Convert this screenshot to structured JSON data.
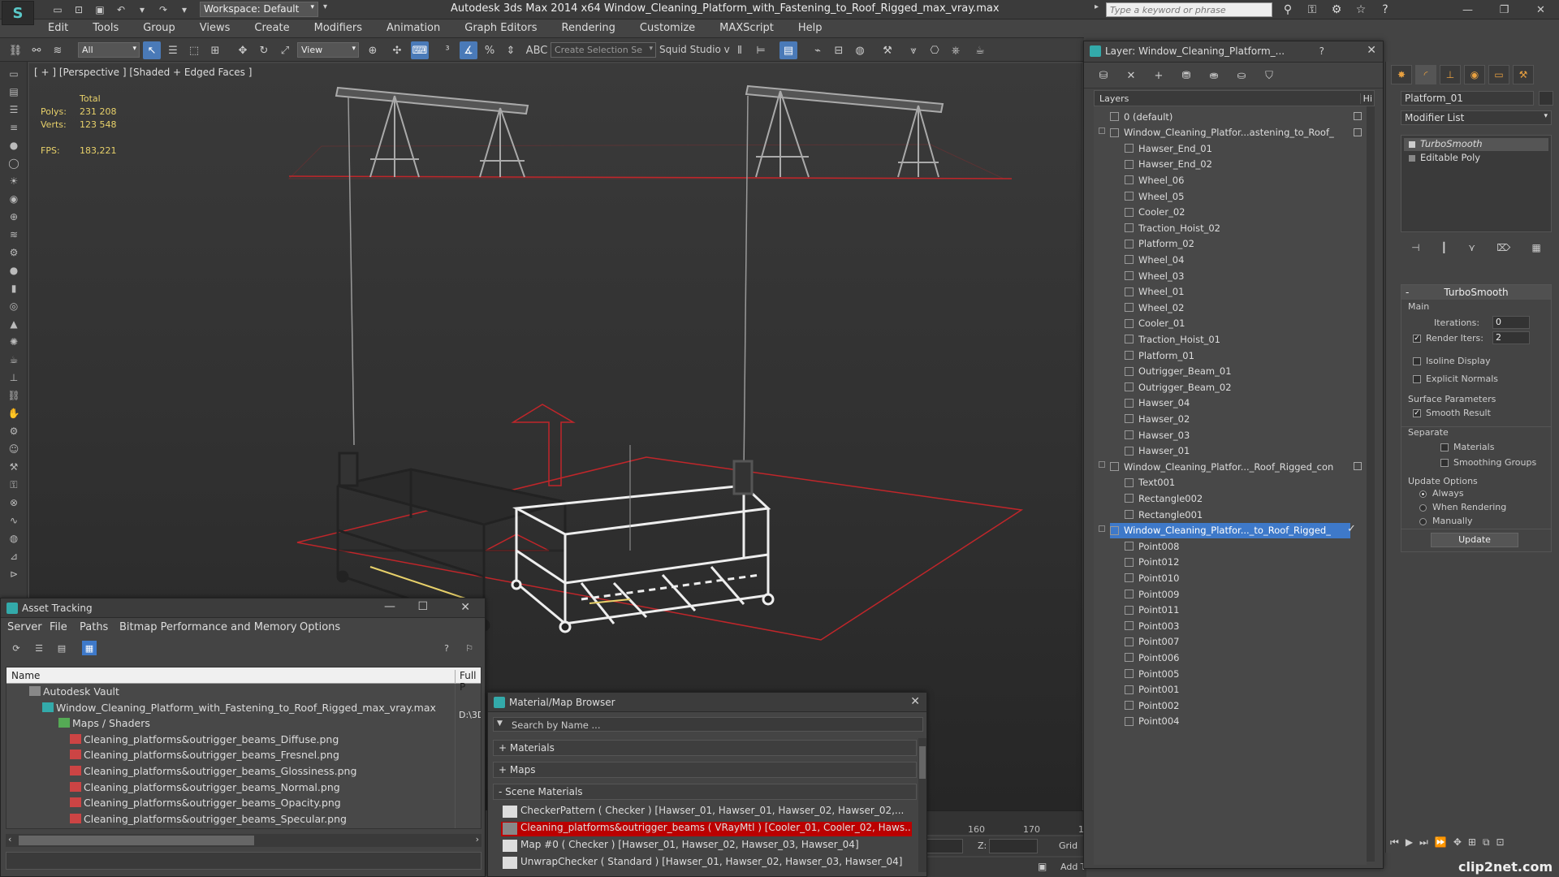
{
  "titlebar": {
    "app_title": "Autodesk 3ds Max  2014 x64     Window_Cleaning_Platform_with_Fastening_to_Roof_Rigged_max_vray.max",
    "workspace": "Workspace: Default",
    "search_placeholder": "Type a keyword or phrase"
  },
  "menu": [
    "Edit",
    "Tools",
    "Group",
    "Views",
    "Create",
    "Modifiers",
    "Animation",
    "Graph Editors",
    "Rendering",
    "Customize",
    "MAXScript",
    "Help"
  ],
  "toolbar": {
    "filter": "All",
    "refcoord": "View",
    "selection_set": "Create Selection Se",
    "studio": "Squid Studio v"
  },
  "viewport": {
    "label": "[ + ] [Perspective ] [Shaded + Edged Faces ]",
    "stats_total": "Total",
    "polys_label": "Polys:",
    "polys": "231 208",
    "verts_label": "Verts:",
    "verts": "123 548",
    "fps_label": "FPS:",
    "fps": "183,221"
  },
  "timeline": {
    "t160": "160",
    "t170": "170",
    "t1": "1"
  },
  "status": {
    "z_label": "Z:",
    "grid": "Grid",
    "add_t": "Add T"
  },
  "layer_explorer": {
    "title": "Layer: Window_Cleaning_Platform_...",
    "help": "?",
    "col_layers": "Layers",
    "col_hide": "Hi",
    "rows": [
      {
        "label": "0 (default)",
        "level": 0,
        "type": "layer",
        "box": true
      },
      {
        "label": "Window_Cleaning_Platfor...astening_to_Roof_",
        "level": 0,
        "type": "layer",
        "box": true
      },
      {
        "label": "Hawser_End_01",
        "level": 1,
        "type": "obj"
      },
      {
        "label": "Hawser_End_02",
        "level": 1,
        "type": "obj"
      },
      {
        "label": "Wheel_06",
        "level": 1,
        "type": "obj"
      },
      {
        "label": "Wheel_05",
        "level": 1,
        "type": "obj"
      },
      {
        "label": "Cooler_02",
        "level": 1,
        "type": "obj"
      },
      {
        "label": "Traction_Hoist_02",
        "level": 1,
        "type": "obj"
      },
      {
        "label": "Platform_02",
        "level": 1,
        "type": "obj"
      },
      {
        "label": "Wheel_04",
        "level": 1,
        "type": "obj"
      },
      {
        "label": "Wheel_03",
        "level": 1,
        "type": "obj"
      },
      {
        "label": "Wheel_01",
        "level": 1,
        "type": "obj"
      },
      {
        "label": "Wheel_02",
        "level": 1,
        "type": "obj"
      },
      {
        "label": "Cooler_01",
        "level": 1,
        "type": "obj"
      },
      {
        "label": "Traction_Hoist_01",
        "level": 1,
        "type": "obj"
      },
      {
        "label": "Platform_01",
        "level": 1,
        "type": "obj"
      },
      {
        "label": "Outrigger_Beam_01",
        "level": 1,
        "type": "obj"
      },
      {
        "label": "Outrigger_Beam_02",
        "level": 1,
        "type": "obj"
      },
      {
        "label": "Hawser_04",
        "level": 1,
        "type": "obj"
      },
      {
        "label": "Hawser_02",
        "level": 1,
        "type": "obj"
      },
      {
        "label": "Hawser_03",
        "level": 1,
        "type": "obj"
      },
      {
        "label": "Hawser_01",
        "level": 1,
        "type": "obj"
      },
      {
        "label": "Window_Cleaning_Platfor..._Roof_Rigged_con",
        "level": 0,
        "type": "layer",
        "box": true
      },
      {
        "label": "Text001",
        "level": 1,
        "type": "obj"
      },
      {
        "label": "Rectangle002",
        "level": 1,
        "type": "obj"
      },
      {
        "label": "Rectangle001",
        "level": 1,
        "type": "obj"
      },
      {
        "label": "Window_Cleaning_Platfor..._to_Roof_Rigged_",
        "level": 0,
        "type": "layer",
        "selected": true
      },
      {
        "label": "Point008",
        "level": 1,
        "type": "obj"
      },
      {
        "label": "Point012",
        "level": 1,
        "type": "obj"
      },
      {
        "label": "Point010",
        "level": 1,
        "type": "obj"
      },
      {
        "label": "Point009",
        "level": 1,
        "type": "obj"
      },
      {
        "label": "Point011",
        "level": 1,
        "type": "obj"
      },
      {
        "label": "Point003",
        "level": 1,
        "type": "obj"
      },
      {
        "label": "Point007",
        "level": 1,
        "type": "obj"
      },
      {
        "label": "Point006",
        "level": 1,
        "type": "obj"
      },
      {
        "label": "Point005",
        "level": 1,
        "type": "obj"
      },
      {
        "label": "Point001",
        "level": 1,
        "type": "obj"
      },
      {
        "label": "Point002",
        "level": 1,
        "type": "obj"
      },
      {
        "label": "Point004",
        "level": 1,
        "type": "obj"
      }
    ]
  },
  "command_panel": {
    "object_name": "Platform_01",
    "modifier_list": "Modifier List",
    "stack": [
      "TurboSmooth",
      "Editable Poly"
    ],
    "rollout_title": "TurboSmooth",
    "main": "Main",
    "iterations_label": "Iterations:",
    "iterations": "0",
    "render_iters_label": "Render Iters:",
    "render_iters": "2",
    "isoline": "Isoline Display",
    "explicit": "Explicit Normals",
    "surface_params": "Surface Parameters",
    "smooth_result": "Smooth Result",
    "separate": "Separate",
    "materials": "Materials",
    "smoothing_groups": "Smoothing Groups",
    "update_options": "Update Options",
    "always": "Always",
    "when_rendering": "When Rendering",
    "manually": "Manually",
    "update": "Update"
  },
  "asset_tracking": {
    "title": "Asset Tracking",
    "menu": [
      "Server",
      "File",
      "Paths",
      "Bitmap Performance and Memory",
      "Options"
    ],
    "col_name": "Name",
    "col_path": "Full P",
    "path_value": "D:\\3D",
    "rows": [
      {
        "label": "Autodesk Vault",
        "level": 0
      },
      {
        "label": "Window_Cleaning_Platform_with_Fastening_to_Roof_Rigged_max_vray.max",
        "level": 1
      },
      {
        "label": "Maps / Shaders",
        "level": 2
      },
      {
        "label": "Cleaning_platforms&outrigger_beams_Diffuse.png",
        "level": 3
      },
      {
        "label": "Cleaning_platforms&outrigger_beams_Fresnel.png",
        "level": 3
      },
      {
        "label": "Cleaning_platforms&outrigger_beams_Glossiness.png",
        "level": 3
      },
      {
        "label": "Cleaning_platforms&outrigger_beams_Normal.png",
        "level": 3
      },
      {
        "label": "Cleaning_platforms&outrigger_beams_Opacity.png",
        "level": 3
      },
      {
        "label": "Cleaning_platforms&outrigger_beams_Specular.png",
        "level": 3
      }
    ]
  },
  "material_browser": {
    "title": "Material/Map Browser",
    "search": "Search by Name ...",
    "groups": [
      "+ Materials",
      "+ Maps",
      "- Scene Materials"
    ],
    "rows": [
      {
        "label": "CheckerPattern  ( Checker )  [Hawser_01, Hawser_01, Hawser_02, Hawser_02,...",
        "hl": false
      },
      {
        "label": "Cleaning_platforms&outrigger_beams  ( VRayMtl ) [Cooler_01, Cooler_02, Haws...",
        "hl": true
      },
      {
        "label": "Map #0  ( Checker )  [Hawser_01, Hawser_02, Hawser_03, Hawser_04]",
        "hl": false
      },
      {
        "label": "UnwrapChecker  ( Standard )  [Hawser_01, Hawser_02, Hawser_03, Hawser_04]",
        "hl": false
      }
    ]
  },
  "watermark": "clip2net.com",
  "colors": {
    "selection": "#3e79c9",
    "stats": "#e8d16a",
    "grid_red": "#c0262a",
    "highlight_red": "#bb0000"
  }
}
